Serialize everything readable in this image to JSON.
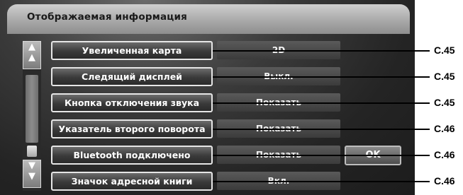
{
  "title": "Отображаемая информация",
  "scroll": {
    "up_label": "▲\n▲",
    "down_label": "▼\n▼"
  },
  "rows": [
    {
      "label": "Увеличенная карта",
      "value": "2D",
      "ref": "C.45"
    },
    {
      "label": "Следящий дисплей",
      "value": "Выкл.",
      "ref": "C.45"
    },
    {
      "label": "Кнопка отключения звука",
      "value": "Показать",
      "ref": "C.45"
    },
    {
      "label": "Указатель второго поворота",
      "value": "Показать",
      "ref": "C.46"
    },
    {
      "label": "Bluetooth подключено",
      "value": "Показать",
      "ref": "C.46"
    },
    {
      "label": "Значок адресной книги",
      "value": "Вкл.",
      "ref": "C.46"
    }
  ],
  "ok_label": "OK"
}
